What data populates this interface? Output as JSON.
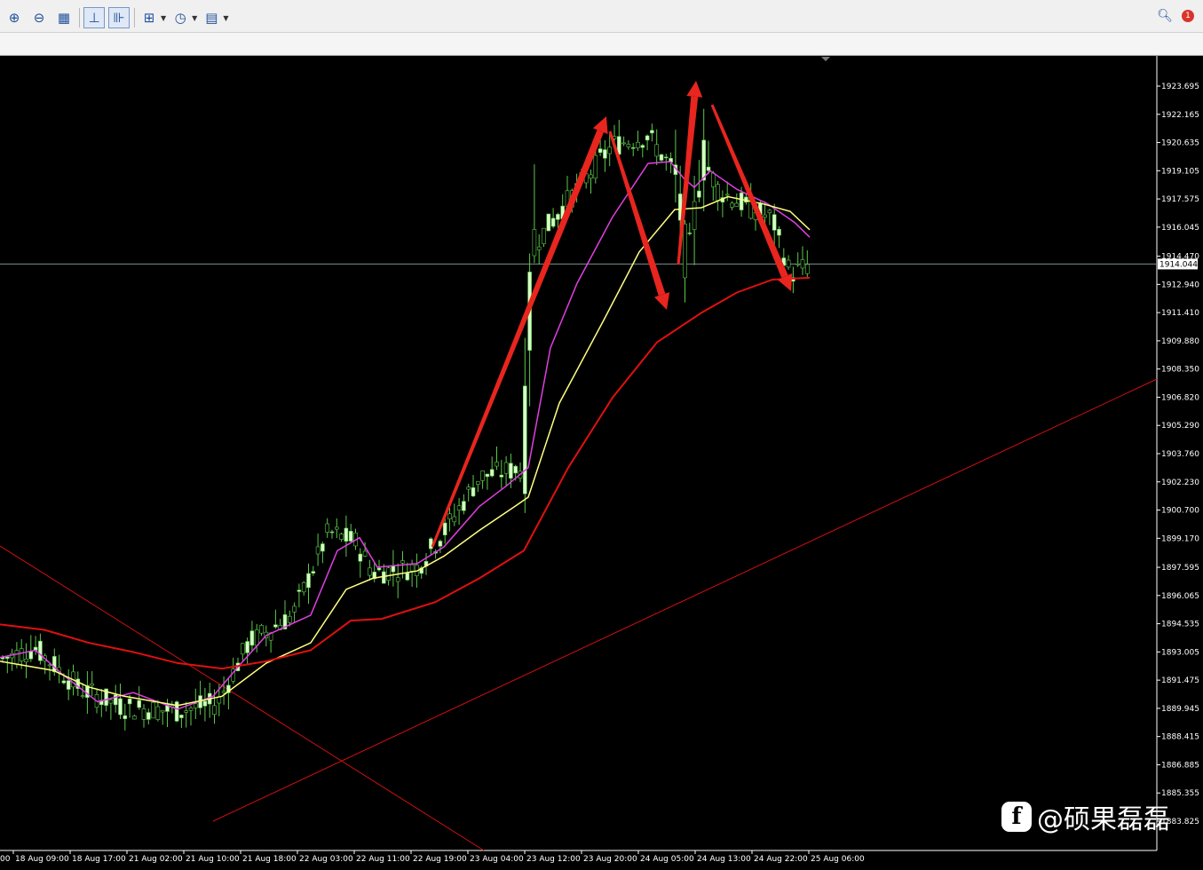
{
  "toolbar": {
    "buttons": [
      {
        "name": "zoom-in-button",
        "icon": "zoom-in-icon",
        "glyph": "⊕"
      },
      {
        "name": "zoom-out-button",
        "icon": "zoom-out-icon",
        "glyph": "⊖"
      },
      {
        "name": "tile-windows-button",
        "icon": "grid-icon",
        "glyph": "▦"
      },
      {
        "name": "chart-shift-button",
        "icon": "chart-shift-icon",
        "glyph": "⊥"
      },
      {
        "name": "auto-scroll-button",
        "icon": "auto-scroll-icon",
        "glyph": "⊪"
      },
      {
        "name": "indicators-button",
        "icon": "add-indicator-icon",
        "glyph": "⊞"
      },
      {
        "name": "periods-button",
        "icon": "clock-icon",
        "glyph": "◷"
      },
      {
        "name": "templates-button",
        "icon": "template-icon",
        "glyph": "▤"
      }
    ],
    "notification_count": "1"
  },
  "chart": {
    "price_levels": [
      "1923.695",
      "1922.165",
      "1920.635",
      "1919.105",
      "1917.575",
      "1916.045",
      "1914.470",
      "1912.940",
      "1911.410",
      "1909.880",
      "1908.350",
      "1906.820",
      "1905.290",
      "1903.760",
      "1902.230",
      "1900.700",
      "1899.170",
      "1897.595",
      "1896.065",
      "1894.535",
      "1893.005",
      "1891.475",
      "1889.945",
      "1888.415",
      "1886.885",
      "1885.355",
      "1883.825"
    ],
    "current_price": "1914.044",
    "time_labels": [
      "18 Aug 09:00",
      "18 Aug 17:00",
      "21 Aug 02:00",
      "21 Aug 10:00",
      "21 Aug 18:00",
      "22 Aug 03:00",
      "22 Aug 11:00",
      "22 Aug 19:00",
      "23 Aug 04:00",
      "23 Aug 12:00",
      "23 Aug 20:00",
      "24 Aug 05:00",
      "24 Aug 13:00",
      "24 Aug 22:00",
      "25 Aug 06:00"
    ],
    "first_time_fragment": "00",
    "colors": {
      "background": "#000000",
      "bull": "#d8ffc8",
      "bear": "#000000",
      "wick": "#5cc84a",
      "ma_fast": "#e040e0",
      "ma_mid": "#ffff80",
      "ma_slow": "#e01010",
      "arrow": "#e8251e",
      "trendline": "#d01010",
      "grid": "#ffffff"
    }
  },
  "watermark": {
    "logo_glyph": "f",
    "text": "@硕果磊磊"
  }
}
